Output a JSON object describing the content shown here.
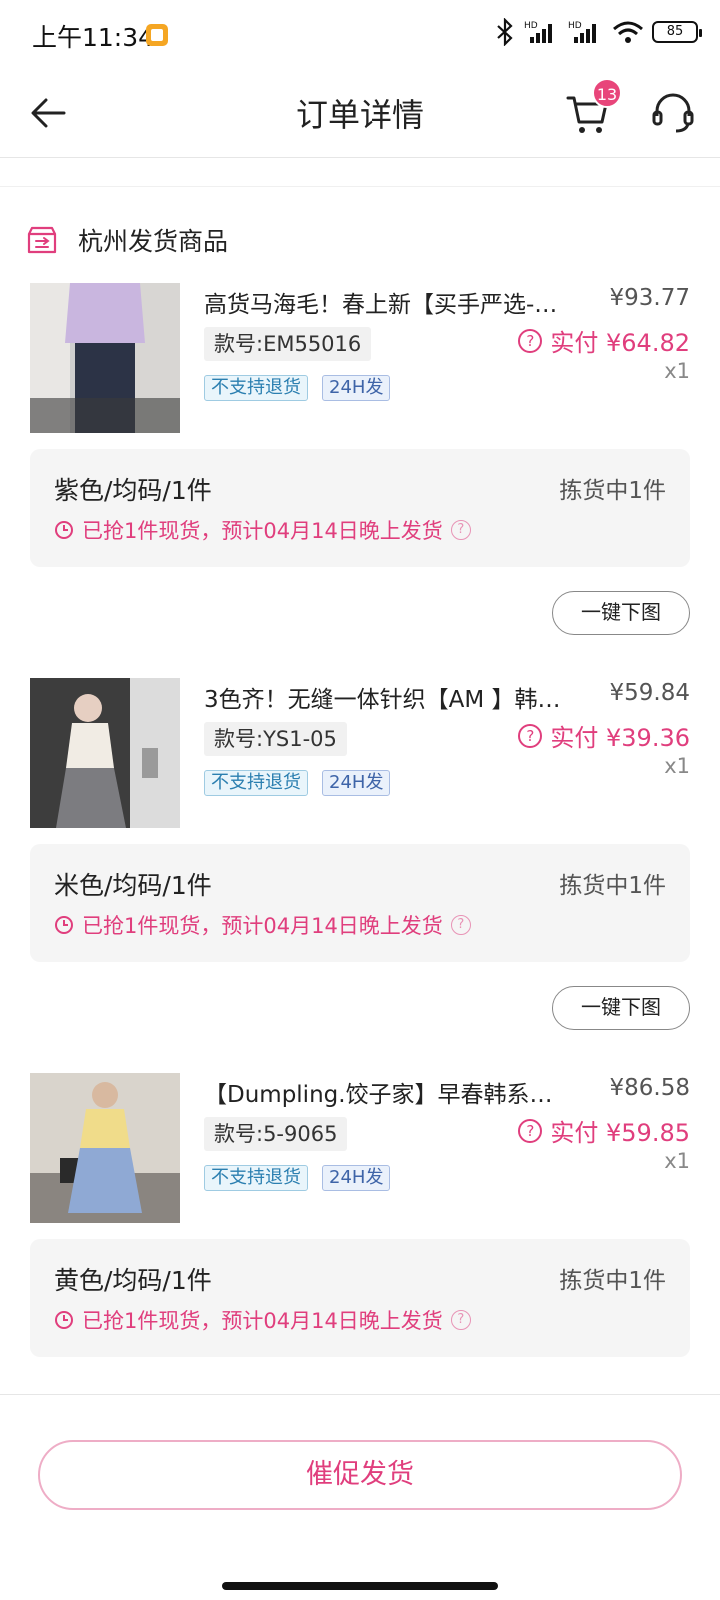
{
  "status_bar": {
    "time": "上午11:34",
    "battery": "85",
    "signal_label_1": "HD",
    "signal_label_2": "HD"
  },
  "nav": {
    "title": "订单详情",
    "cart_badge": "13"
  },
  "warehouse": {
    "label": "杭州发货商品"
  },
  "colors": {
    "accent": "#e03e7d",
    "badge": "#e8457a"
  },
  "products": [
    {
      "title": "高货马海毛！春上新【买手严选-…",
      "price": "¥93.77",
      "sku": "款号:EM55016",
      "paid": "实付 ¥64.82",
      "qty": "x1",
      "tag_noreturn": "不支持退货",
      "tag_24h": "24H发",
      "spec": "紫色/均码/1件",
      "spec_status": "拣货中1件",
      "note": "已抢1件现货，预计04月14日晚上发货",
      "download": "一键下图"
    },
    {
      "title": "3色齐！无缝一体针织【AM 】韩…",
      "price": "¥59.84",
      "sku": "款号:YS1-05",
      "paid": "实付 ¥39.36",
      "qty": "x1",
      "tag_noreturn": "不支持退货",
      "tag_24h": "24H发",
      "spec": "米色/均码/1件",
      "spec_status": "拣货中1件",
      "note": "已抢1件现货，预计04月14日晚上发货",
      "download": "一键下图"
    },
    {
      "title": "【Dumpling.饺子家】早春韩系…",
      "price": "¥86.58",
      "sku": "款号:5-9065",
      "paid": "实付 ¥59.85",
      "qty": "x1",
      "tag_noreturn": "不支持退货",
      "tag_24h": "24H发",
      "spec": "黄色/均码/1件",
      "spec_status": "拣货中1件",
      "note": "已抢1件现货，预计04月14日晚上发货"
    }
  ],
  "actions": {
    "urge": "催促发货"
  }
}
